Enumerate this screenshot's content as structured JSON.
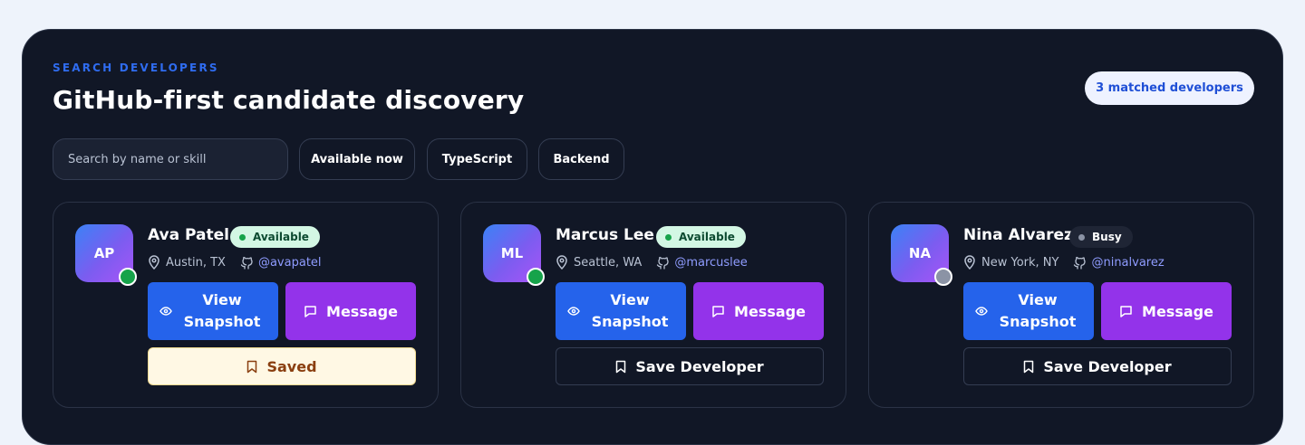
{
  "header": {
    "eyebrow": "SEARCH DEVELOPERS",
    "title": "GitHub-first candidate discovery",
    "match_count": "3 matched developers"
  },
  "filters": {
    "search_placeholder": "Search by name or skill",
    "search_value": "",
    "chips": [
      "Available now",
      "TypeScript",
      "Backend"
    ]
  },
  "colors": {
    "accent_blue": "#2563eb",
    "accent_purple": "#9333ea",
    "available_green": "#16a34a",
    "busy_gray": "#8b93a5"
  },
  "developers": [
    {
      "initials": "AP",
      "name": "Ava Patel",
      "status": "Available",
      "location": "Austin, TX",
      "github": "@avapatel",
      "view_label": "View Snapshot",
      "message_label": "Message",
      "save_label": "Saved"
    },
    {
      "initials": "ML",
      "name": "Marcus Lee",
      "status": "Available",
      "location": "Seattle, WA",
      "github": "@marcuslee",
      "view_label": "View Snapshot",
      "message_label": "Message",
      "save_label": "Save Developer"
    },
    {
      "initials": "NA",
      "name": "Nina Alvarez",
      "status": "Busy",
      "location": "New York, NY",
      "github": "@ninalvarez",
      "view_label": "View Snapshot",
      "message_label": "Message",
      "save_label": "Save Developer"
    }
  ],
  "icons": {
    "location": "map-pin-icon",
    "github": "github-icon",
    "view": "eye-icon",
    "message": "chat-bubble-icon",
    "save": "bookmark-icon"
  }
}
